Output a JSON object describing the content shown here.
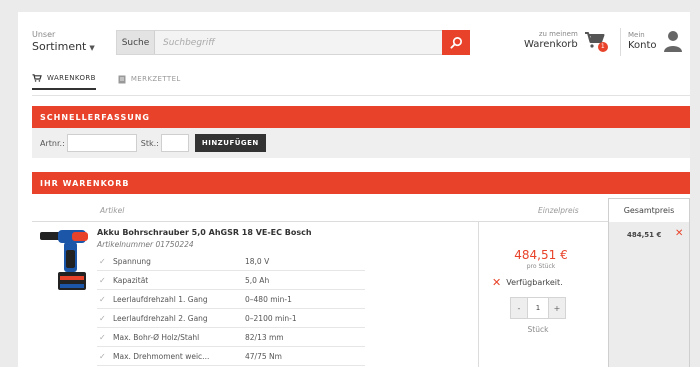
{
  "header": {
    "assortment_small": "Unser",
    "assortment_big": "Sortiment",
    "search_label": "Suche",
    "search_placeholder": "Suchbegriff",
    "cart_small": "zu meinem",
    "cart_big": "Warenkorb",
    "cart_count": "1",
    "account_small": "Mein",
    "account_big": "Konto"
  },
  "tabs": [
    {
      "label": "WARENKORB",
      "icon": "cart-icon",
      "active": true
    },
    {
      "label": "MERKZETTEL",
      "icon": "notepad-icon",
      "active": false
    }
  ],
  "quick_entry": {
    "title": "SCHNELLERFASSUNG",
    "artnr_label": "Artnr.:",
    "qty_label": "Stk.:",
    "add_button": "HINZUFÜGEN"
  },
  "cart": {
    "title": "IHR WARENKORB",
    "columns": {
      "article": "Artikel",
      "unit_price": "Einzelpreis",
      "total": "Gesamtpreis"
    },
    "item": {
      "name": "Akku Bohrschrauber 5,0 AhGSR 18 VE-EC Bosch",
      "article_number": "Artikelnummer 01750224",
      "specs": [
        {
          "key": "Spannung",
          "value": "18,0 V"
        },
        {
          "key": "Kapazität",
          "value": "5,0 Ah"
        },
        {
          "key": "Leerlaufdrehzahl 1. Gang",
          "value": "0–480 min-1"
        },
        {
          "key": "Leerlaufdrehzahl 2. Gang",
          "value": "0–2100 min-1"
        },
        {
          "key": "Max. Bohr-Ø Holz/Stahl",
          "value": "82/13 mm"
        },
        {
          "key": "Max. Drehmoment weic...",
          "value": "47/75 Nm"
        }
      ],
      "price": "484,51 €",
      "price_per": "pro Stück",
      "availability": "Verfügbarkeit.",
      "quantity": "1",
      "qty_minus": "-",
      "qty_plus": "+",
      "unit": "Stück",
      "total": "484,51 €"
    }
  },
  "colors": {
    "accent": "#e8432a",
    "dark": "#333333",
    "total_col_bg": "#ececec"
  }
}
